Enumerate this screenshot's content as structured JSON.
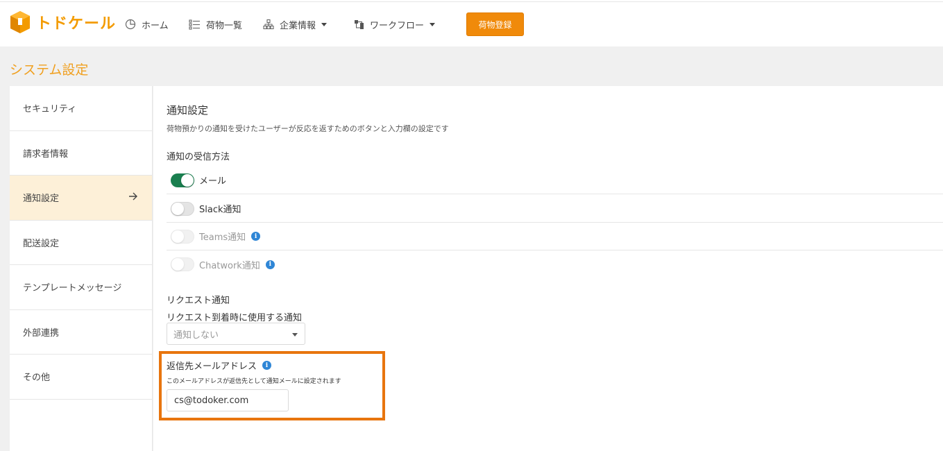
{
  "header": {
    "logo_text": "トドケール",
    "nav": [
      {
        "label": "ホーム",
        "icon": "chart-pie-icon"
      },
      {
        "label": "荷物一覧",
        "icon": "list-icon"
      },
      {
        "label": "企業情報",
        "icon": "org-chart-icon"
      },
      {
        "label": "ワークフロー",
        "icon": "workflow-icon"
      }
    ],
    "primary_button": "荷物登録"
  },
  "page_title": "システム設定",
  "sidebar": {
    "items": [
      {
        "label": "セキュリティ"
      },
      {
        "label": "請求者情報"
      },
      {
        "label": "通知設定"
      },
      {
        "label": "配送設定"
      },
      {
        "label": "テンプレートメッセージ"
      },
      {
        "label": "外部連携"
      },
      {
        "label": "その他"
      }
    ]
  },
  "main": {
    "title": "通知設定",
    "description": "荷物預かりの通知を受けたユーザーが反応を返すためのボタンと入力欄の設定です",
    "receive_method_title": "通知の受信方法",
    "toggles": [
      {
        "label": "メール",
        "on": true,
        "disabled": false
      },
      {
        "label": "Slack通知",
        "on": false,
        "disabled": false
      },
      {
        "label": "Teams通知",
        "on": false,
        "disabled": true
      },
      {
        "label": "Chatwork通知",
        "on": false,
        "disabled": true
      }
    ],
    "request_title": "リクエスト通知",
    "request_label": "リクエスト到着時に使用する通知",
    "request_select_value": "通知しない",
    "reply_title": "返信先メールアドレス",
    "reply_desc": "このメールアドレスが返信先として通知メールに設定されます",
    "reply_email": "cs@todoker.com"
  },
  "colors": {
    "brand": "#f39b00",
    "primary_button": "#f08a0a",
    "highlight": "#e8750e",
    "toggle_on": "#1a7f4f",
    "info": "#2f86d6",
    "active_bg": "#fdf0d8"
  }
}
